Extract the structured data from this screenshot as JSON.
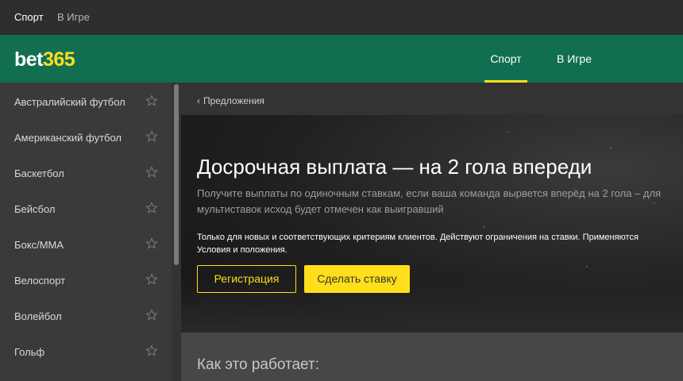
{
  "topbar": {
    "links": [
      "Спорт",
      "В Игре"
    ]
  },
  "header": {
    "logo_main": "bet",
    "logo_accent": "365",
    "nav": [
      "Спорт",
      "В Игре"
    ],
    "active_nav": "Спорт"
  },
  "sidebar": {
    "items": [
      {
        "label": "Австралийский футбол",
        "icon": "star-icon"
      },
      {
        "label": "Американский футбол",
        "icon": "star-icon"
      },
      {
        "label": "Баскетбол",
        "icon": "star-icon"
      },
      {
        "label": "Бейсбол",
        "icon": "star-icon"
      },
      {
        "label": "Бокс/MMA",
        "icon": "star-icon"
      },
      {
        "label": "Велоспорт",
        "icon": "star-icon"
      },
      {
        "label": "Волейбол",
        "icon": "star-icon"
      },
      {
        "label": "Гольф",
        "icon": "star-icon"
      }
    ]
  },
  "main": {
    "breadcrumb": "Предложения",
    "hero": {
      "title": "Досрочная выплата — на 2 гола впереди",
      "subtitle": "Получите выплаты по одиночным ставкам, если ваша команда вырвется вперёд на 2 гола – для мультиставок исход будет отмечен как выигравший",
      "terms": "Только для новых и соответствующих критериям клиентов. Действуют ограничения на ставки. Применяются Условия и положения.",
      "register_label": "Регистрация",
      "bet_label": "Сделать ставку"
    },
    "how_title": "Как это работает:"
  },
  "colors": {
    "brand_green": "#126e51",
    "accent_yellow": "#ffdf1b",
    "sidebar_bg": "#3a3a3a",
    "topbar_bg": "#2e2e2e"
  }
}
